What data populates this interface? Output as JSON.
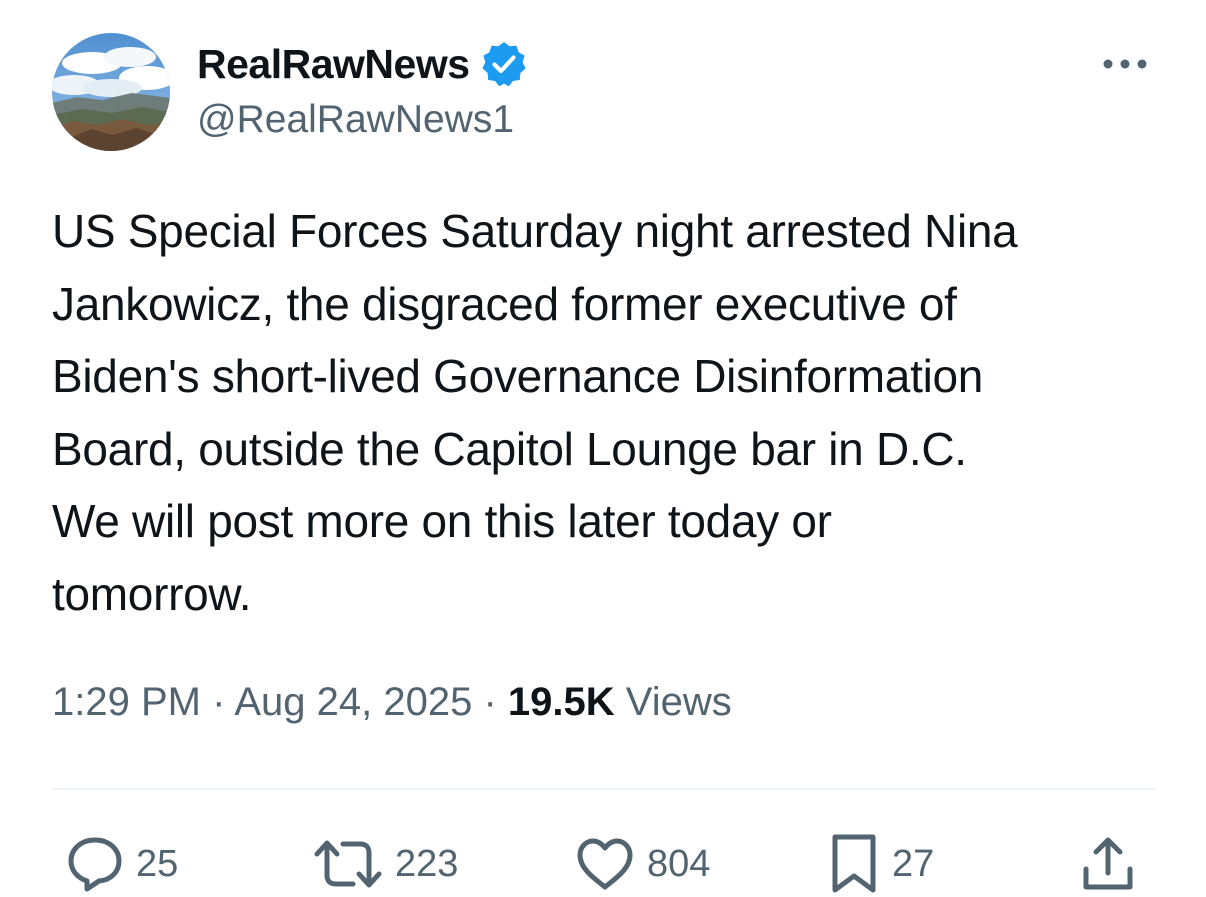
{
  "author": {
    "display_name": "RealRawNews",
    "handle": "@RealRawNews1",
    "verified": true,
    "verified_color": "#1d9bf0",
    "avatar_icon": "landscape-avatar-icon"
  },
  "tweet": {
    "text": "US Special Forces Saturday night arrested Nina\nJankowicz, the disgraced former executive of\nBiden's short-lived Governance Disinformation\nBoard, outside the Capitol Lounge bar in D.C.\nWe will post more on this later today or\ntomorrow."
  },
  "meta": {
    "time": "1:29 PM",
    "separator": "·",
    "date": "Aug 24, 2025",
    "views_count": "19.5K",
    "views_label": "Views"
  },
  "actions": {
    "replies": "25",
    "reposts": "223",
    "likes": "804",
    "bookmarks": "27"
  },
  "colors": {
    "text_primary": "#0f1419",
    "text_secondary": "#536471",
    "divider": "#eff3f4"
  }
}
